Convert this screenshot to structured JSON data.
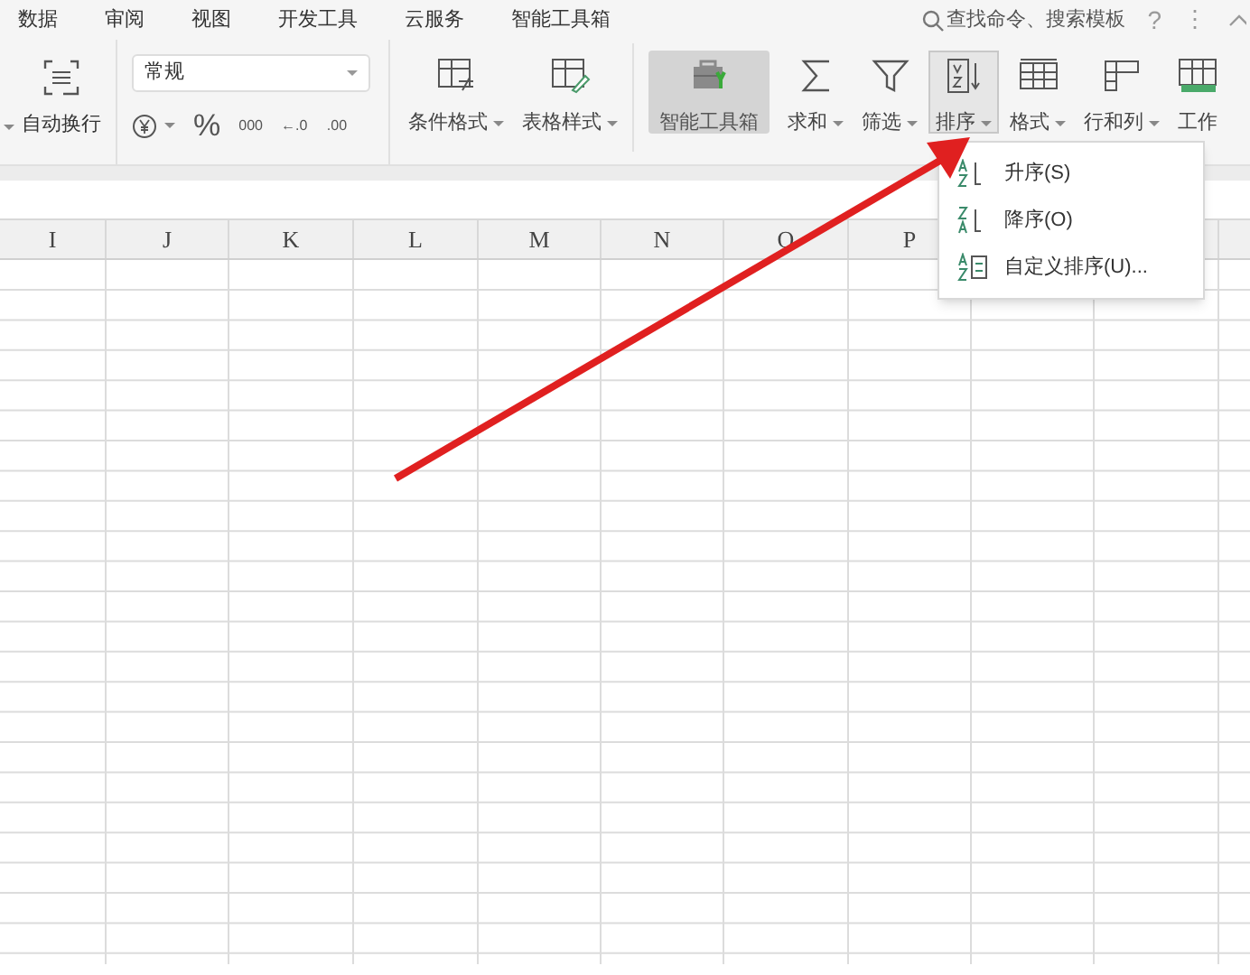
{
  "menu_tabs": [
    {
      "label": "数据"
    },
    {
      "label": "审阅"
    },
    {
      "label": "视图"
    },
    {
      "label": "开发工具"
    },
    {
      "label": "云服务"
    },
    {
      "label": "智能工具箱"
    }
  ],
  "search": {
    "placeholder": "查找命令、搜索模板"
  },
  "help": "?",
  "more": "⋮",
  "wrap_button": {
    "label": "自动换行"
  },
  "number_format": {
    "value": "常规"
  },
  "number_buttons": [
    "%",
    "000",
    "←.0",
    ".00"
  ],
  "ribbon_buttons": [
    {
      "label": "条件格式",
      "caret": true,
      "kind": "normal",
      "selected": false
    },
    {
      "label": "表格样式",
      "caret": true,
      "kind": "normal",
      "selected": false
    },
    {
      "label": "智能工具箱",
      "caret": false,
      "kind": "toolbox",
      "selected": false
    },
    {
      "label": "求和",
      "caret": true,
      "kind": "normal",
      "selected": false
    },
    {
      "label": "筛选",
      "caret": true,
      "kind": "normal",
      "selected": false
    },
    {
      "label": "排序",
      "caret": true,
      "kind": "normal",
      "selected": true
    },
    {
      "label": "格式",
      "caret": true,
      "kind": "normal",
      "selected": false
    },
    {
      "label": "行和列",
      "caret": true,
      "kind": "normal",
      "selected": false
    },
    {
      "label": "工作",
      "caret": false,
      "kind": "normal",
      "selected": false
    }
  ],
  "sort_menu": [
    {
      "label": "升序(S)"
    },
    {
      "label": "降序(O)"
    },
    {
      "label": "自定义排序(U)..."
    }
  ],
  "columns": [
    "I",
    "J",
    "K",
    "L",
    "M",
    "N",
    "O",
    "P"
  ]
}
